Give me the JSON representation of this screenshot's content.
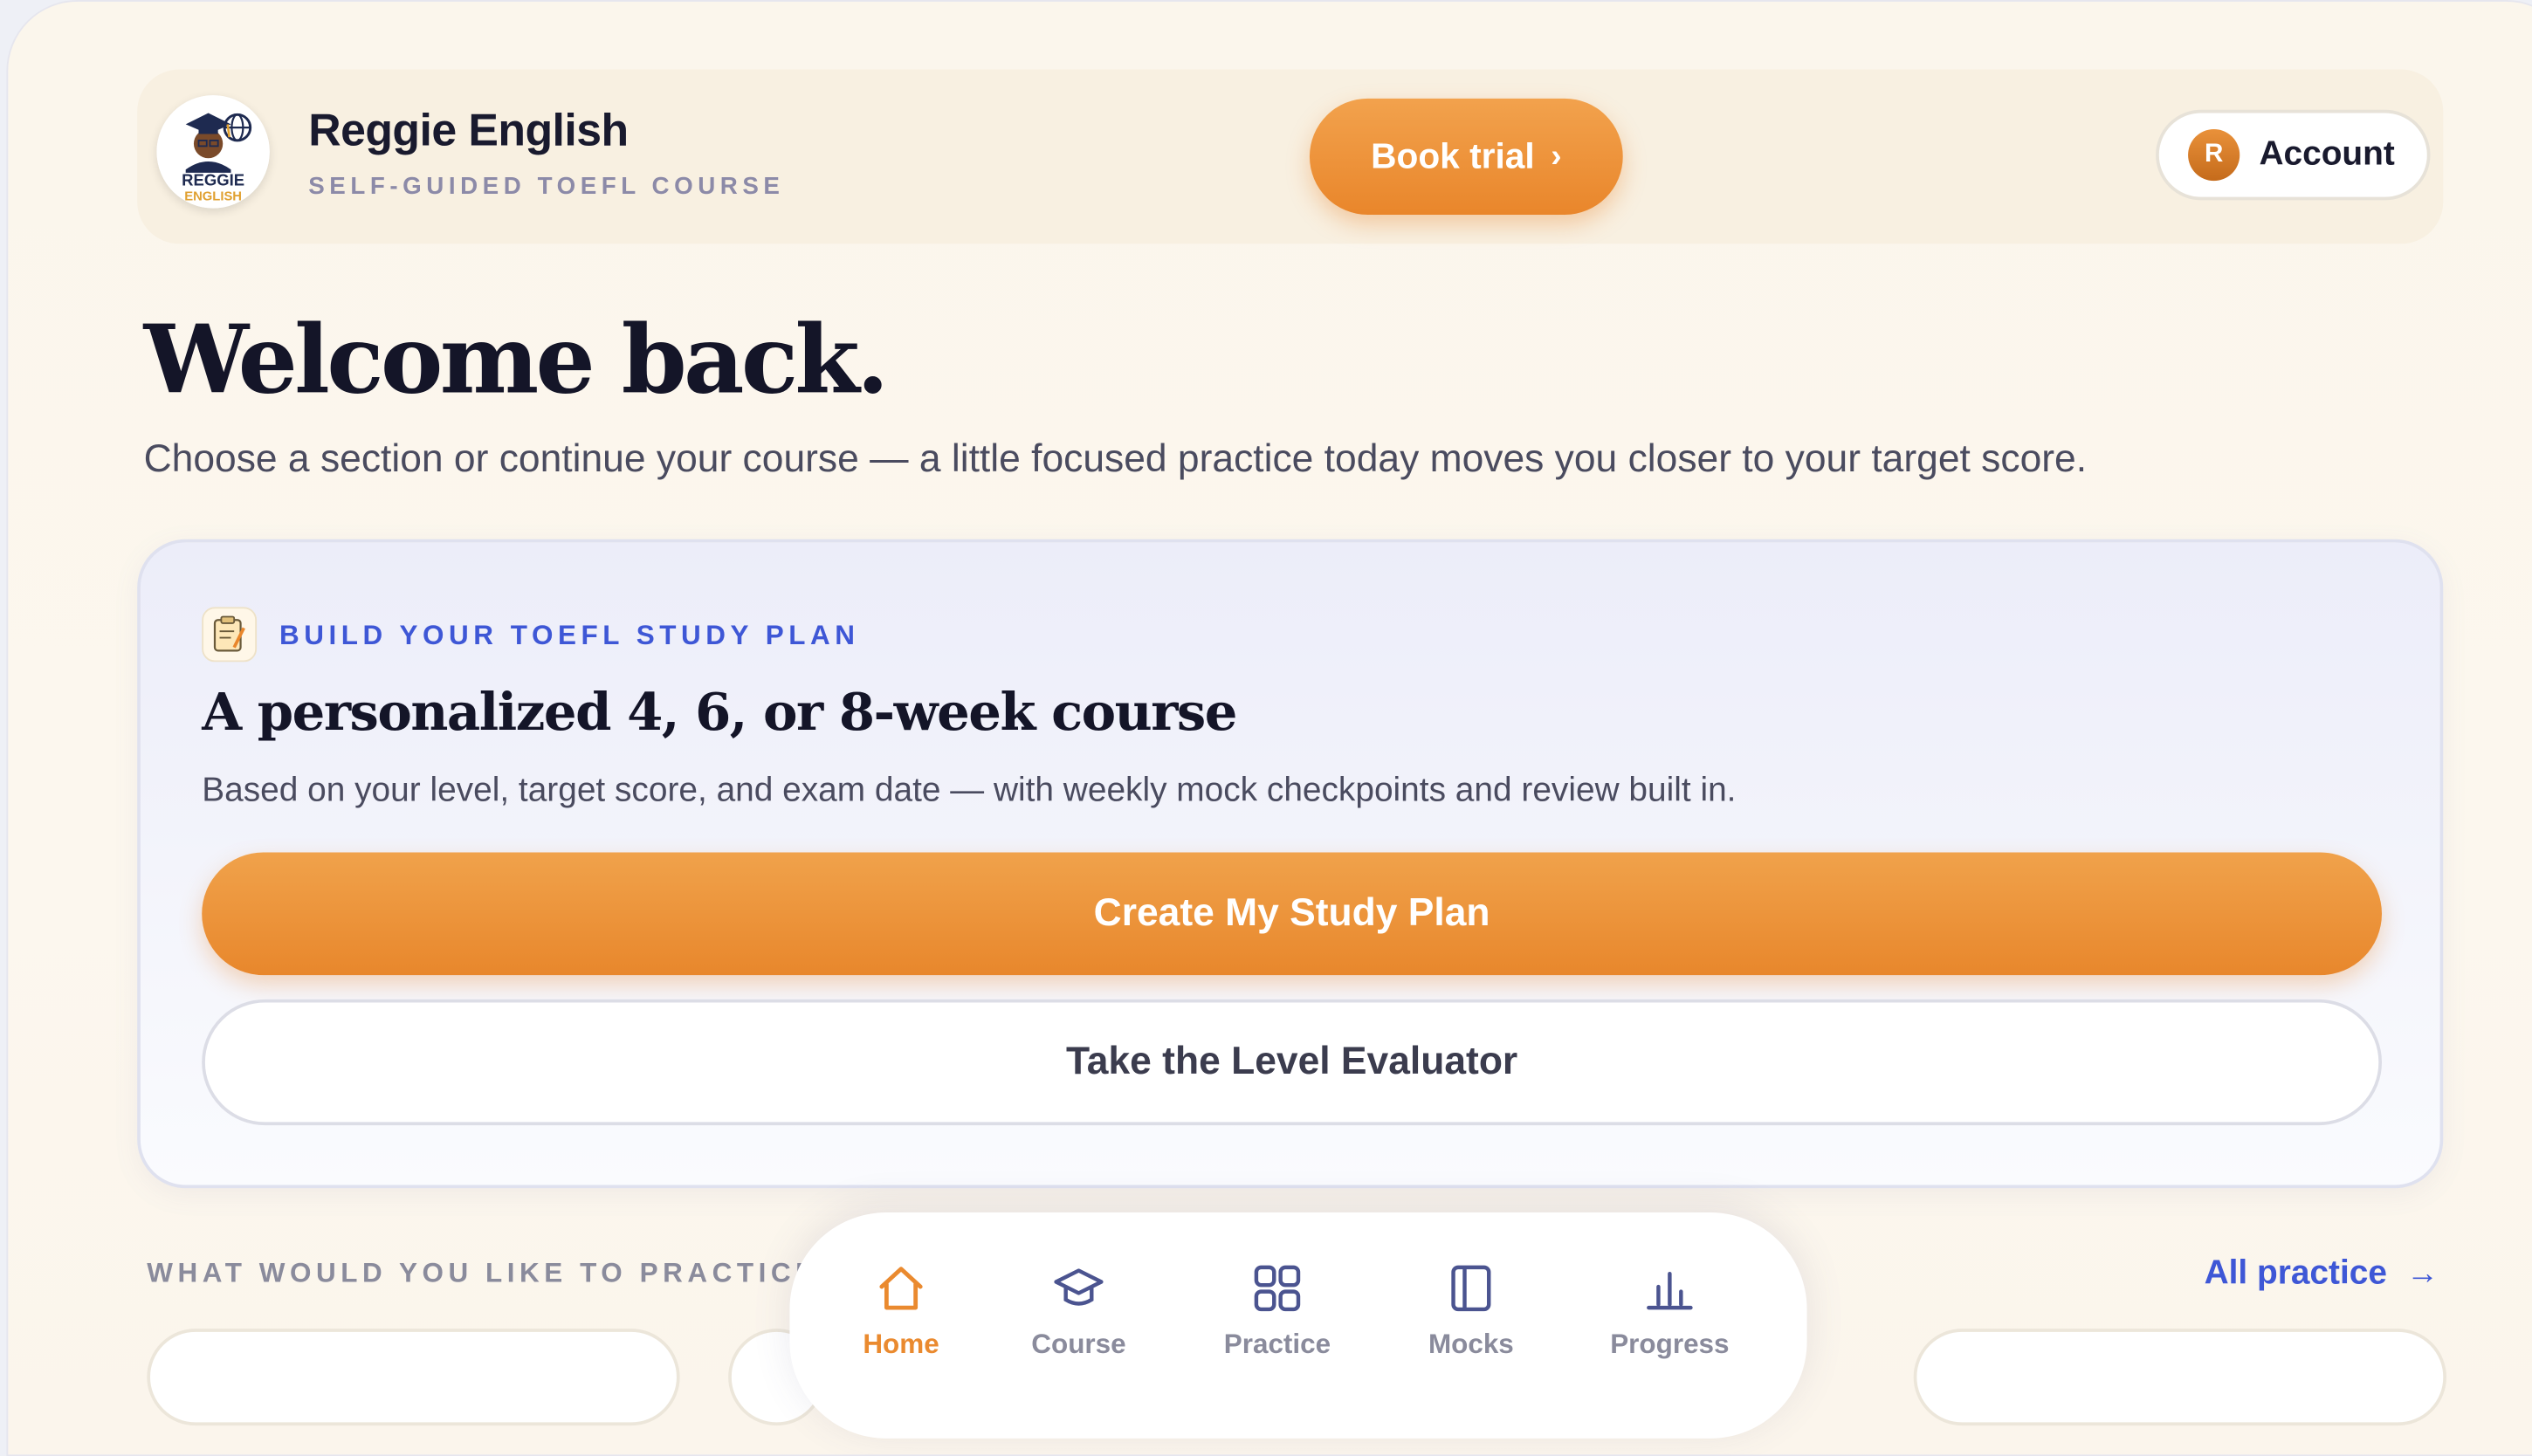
{
  "header": {
    "brand_name": "Reggie English",
    "brand_tagline": "SELF-GUIDED TOEFL COURSE",
    "logo_text_top": "REGGIE",
    "logo_text_bottom": "ENGLISH",
    "book_trial_label": "Book trial",
    "book_trial_chevron": "›",
    "account_initial": "R",
    "account_label": "Account"
  },
  "welcome": {
    "title": "Welcome back.",
    "subtitle": "Choose a section or continue your course — a little focused practice today moves you closer to your target score."
  },
  "plan_card": {
    "kicker": "BUILD YOUR TOEFL STUDY PLAN",
    "title": "A personalized 4, 6, or 8-week course",
    "subtitle": "Based on your level, target score, and exam date — with weekly mock checkpoints and review built in.",
    "primary_button": "Create My Study Plan",
    "secondary_button": "Take the Level Evaluator"
  },
  "practice": {
    "heading": "WHAT WOULD YOU LIKE TO PRACTICE?",
    "all_link": "All practice",
    "all_link_arrow": "→"
  },
  "bottom_nav": {
    "items": [
      {
        "label": "Home",
        "icon": "home-icon",
        "active": true
      },
      {
        "label": "Course",
        "icon": "graduation-cap-icon",
        "active": false
      },
      {
        "label": "Practice",
        "icon": "grid-icon",
        "active": false
      },
      {
        "label": "Mocks",
        "icon": "book-icon",
        "active": false
      },
      {
        "label": "Progress",
        "icon": "bar-chart-icon",
        "active": false
      }
    ]
  },
  "colors": {
    "accent_orange": "#e9862b",
    "accent_blue": "#3e57d6",
    "ink": "#141528"
  }
}
